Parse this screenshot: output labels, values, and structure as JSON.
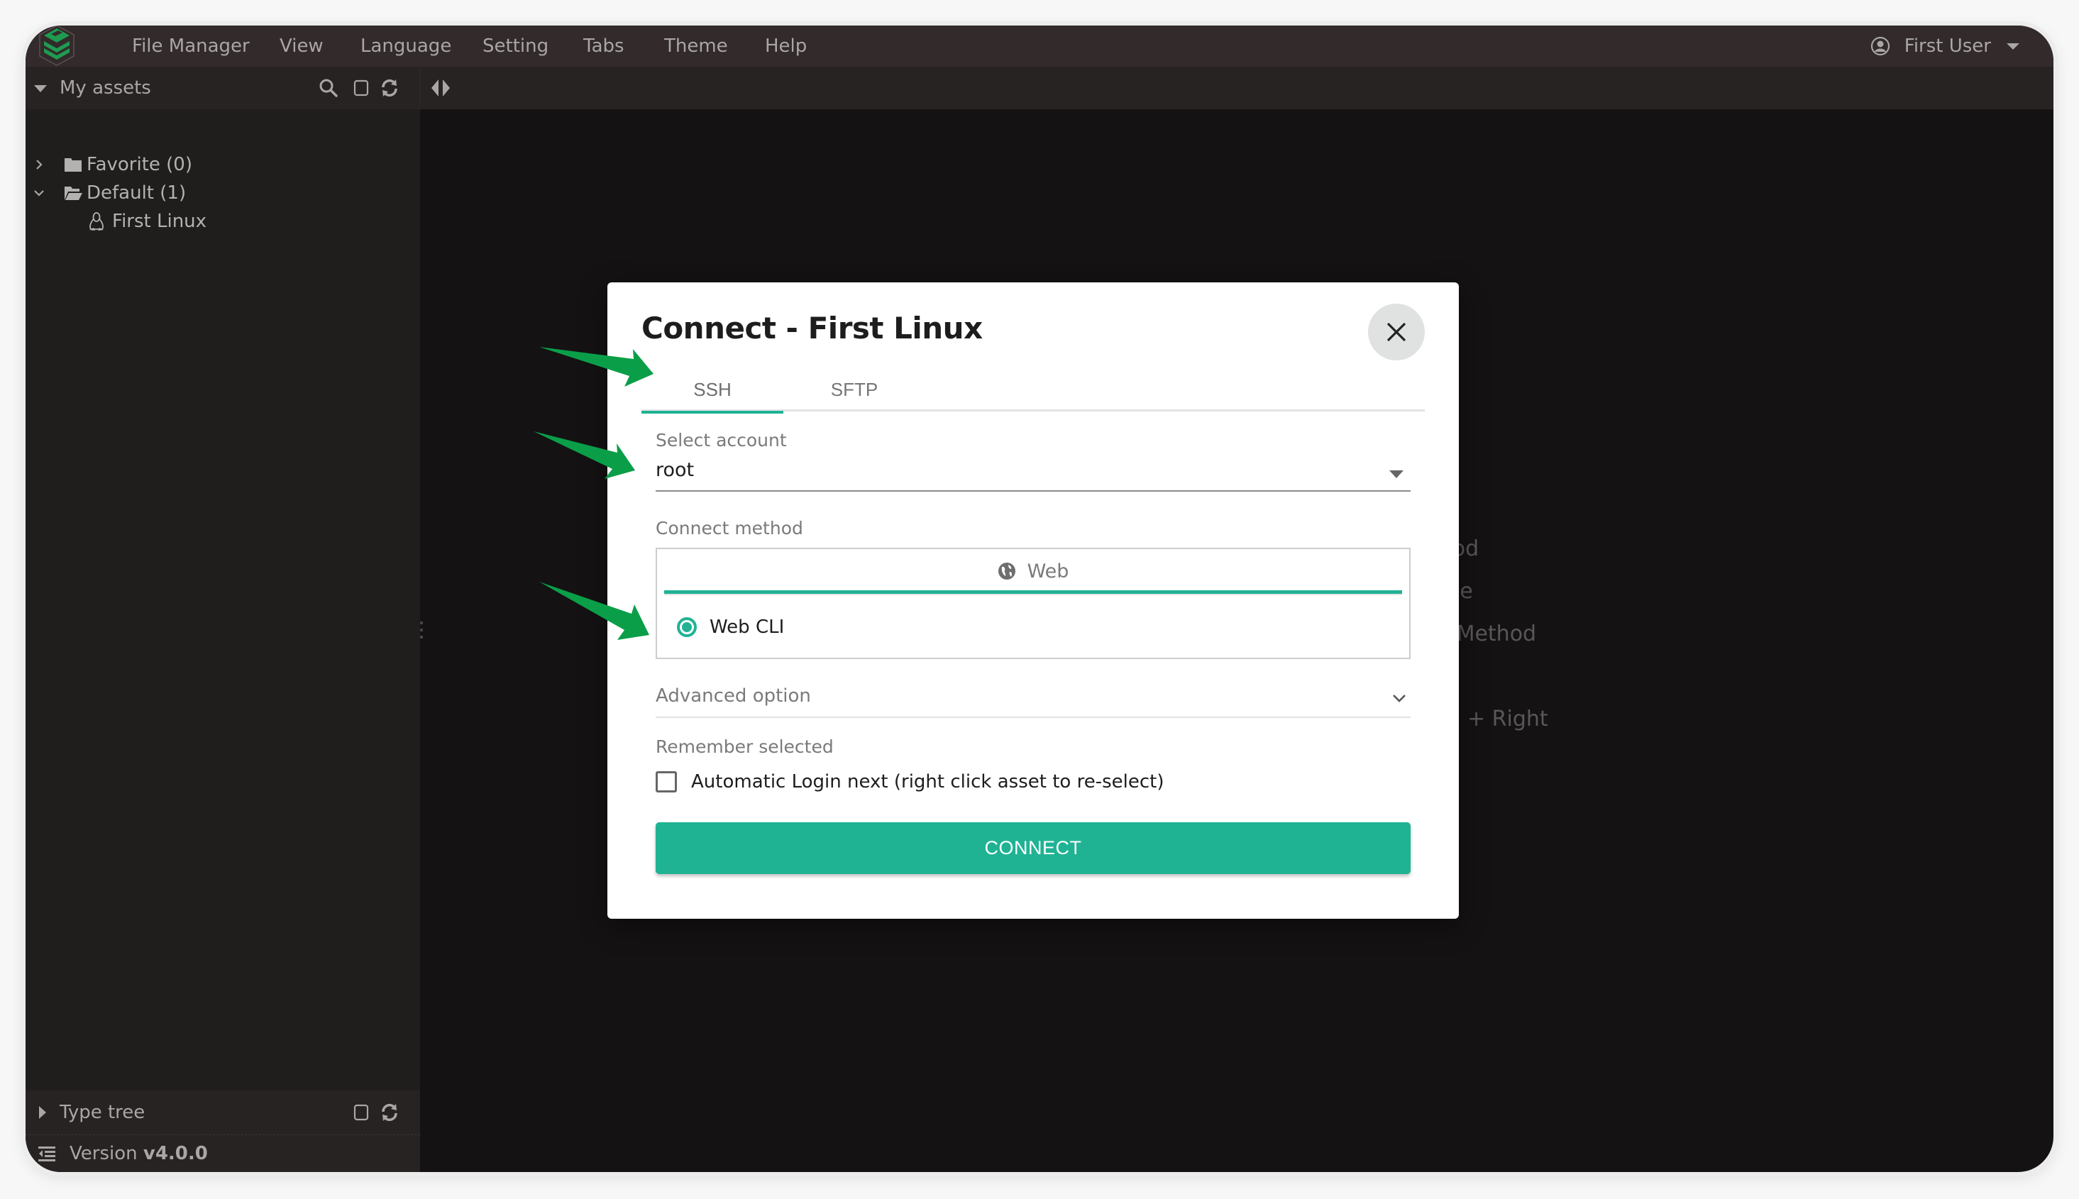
{
  "menubar": {
    "items": [
      "File Manager",
      "View",
      "Language",
      "Setting",
      "Tabs",
      "Theme",
      "Help"
    ],
    "user": {
      "name": "First User",
      "icon": "user-circle-icon"
    }
  },
  "sidebar": {
    "title": "My assets",
    "tools": [
      "search-icon",
      "square-icon",
      "refresh-icon"
    ],
    "tree": [
      {
        "label": "Favorite (0)",
        "expanded": false,
        "icon": "folder-icon"
      },
      {
        "label": "Default (1)",
        "expanded": true,
        "icon": "folder-open-icon"
      },
      {
        "label": "First Linux",
        "icon": "linux-icon",
        "level": 2
      }
    ],
    "type_tree": {
      "label": "Type tree"
    },
    "version": {
      "label": "Version",
      "value": "v4.0.0"
    }
  },
  "background_fragments": [
    "thod",
    "ode",
    "g Method",
    "+ Right"
  ],
  "dialog": {
    "title": "Connect - First Linux",
    "tabs": [
      {
        "label": "SSH",
        "active": true
      },
      {
        "label": "SFTP",
        "active": false
      }
    ],
    "account": {
      "label": "Select account",
      "value": "root"
    },
    "connect_method": {
      "label": "Connect method",
      "tab_label": "Web",
      "options": [
        {
          "label": "Web CLI",
          "selected": true
        }
      ]
    },
    "advanced": {
      "label": "Advanced option",
      "expanded": false
    },
    "remember": {
      "label": "Remember selected",
      "checkbox_label": "Automatic Login next (right click asset to re-select)",
      "checked": false
    },
    "connect_button": "CONNECT"
  },
  "colors": {
    "accent": "#1fb394",
    "annotation_arrow": "#0a9e48",
    "menubar_bg": "#322a2b",
    "toolbar_bg": "#272322",
    "main_bg": "#141213"
  }
}
